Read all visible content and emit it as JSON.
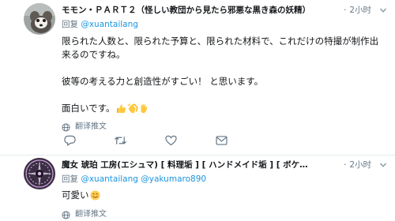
{
  "tweets": [
    {
      "display_name": "モモン・ＰＡＲＴ２（怪しい教団から見たら邪悪な黒き森の妖精）",
      "time": "2小时",
      "reply_prefix": "回复",
      "reply_handles": "@xuantailang",
      "paragraphs": [
        "限られた人数と、限られた予算と、限られた材料で、これだけの特撮が制作出来るのですね。",
        "彼等の考える力と創造性がすごい！ と思います。",
        "面白いです。"
      ],
      "translate_label": "翻译推文"
    },
    {
      "display_name": "魔女 琥珀 工房(エシュマ) [ 料理垢 ] [ ハンドメイド垢 ] [ ボケ…",
      "time": "2小时",
      "reply_prefix": "回复",
      "reply_handles": "@xuantailang @yakumaro890",
      "text": "可愛い",
      "translate_label": "翻译推文"
    }
  ],
  "icons": {
    "reply": "reply-icon",
    "retweet": "retweet-icon",
    "like": "like-icon",
    "dm": "direct-message-icon",
    "caret": "chevron-down-icon",
    "globe": "globe-icon"
  },
  "colors": {
    "link": "#1b95e0",
    "secondary": "#657786",
    "text": "#14171a",
    "divider": "#e6ecf0"
  }
}
